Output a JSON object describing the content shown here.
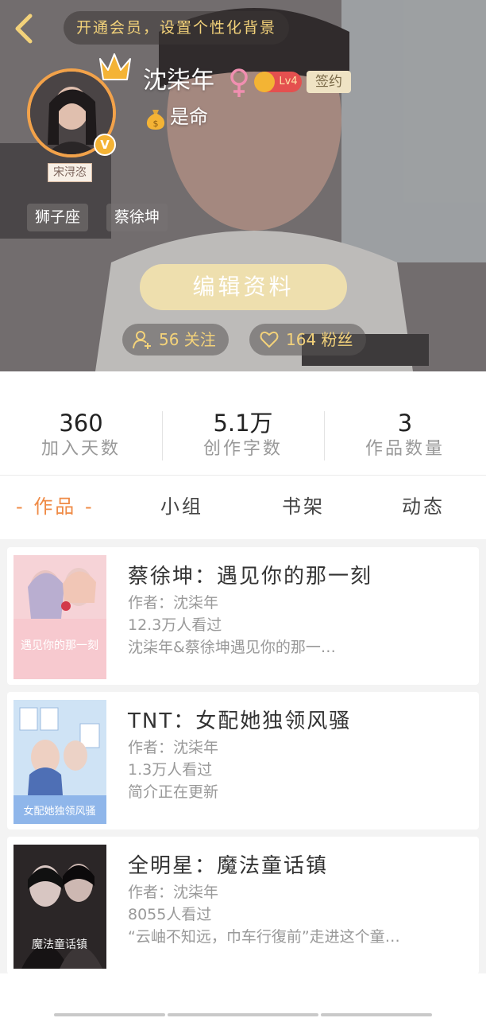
{
  "header": {
    "banner_text": "开通会员，设置个性化背景",
    "username": "沈柒年",
    "level": "Lv4",
    "sign_label": "签约",
    "motto": "是命",
    "avatar_tag": "宋浔恣",
    "verified_mark": "V",
    "tags": [
      "狮子座",
      "蔡徐坤"
    ],
    "edit_label": "编辑资料",
    "follow_label": "56 关注",
    "fans_label": "164 粉丝",
    "accent_color": "#f3d27a"
  },
  "stats": [
    {
      "value": "360",
      "label": "加入天数"
    },
    {
      "value": "5.1万",
      "label": "创作字数"
    },
    {
      "value": "3",
      "label": "作品数量"
    }
  ],
  "tabs": [
    {
      "label": "作品",
      "active": true
    },
    {
      "label": "小组",
      "active": false
    },
    {
      "label": "书架",
      "active": false
    },
    {
      "label": "动态",
      "active": false
    }
  ],
  "tab_active_color": "#ef8a45",
  "books": [
    {
      "title": "蔡徐坤：遇见你的那一刻",
      "author": "作者：沈柒年",
      "views": "12.3万人看过",
      "summary": "沈柒年&蔡徐坤遇见你的那一…",
      "cover_text": "遇见你的那一刻"
    },
    {
      "title": "TNT：女配她独领风骚",
      "author": "作者：沈柒年",
      "views": "1.3万人看过",
      "summary": "简介正在更新",
      "cover_text": "女配她独领风骚"
    },
    {
      "title": "全明星：魔法童话镇",
      "author": "作者：沈柒年",
      "views": "8055人看过",
      "summary": "“云岫不知远，巾车行復前”走进这个童…",
      "cover_text": "魔法童话镇"
    }
  ]
}
